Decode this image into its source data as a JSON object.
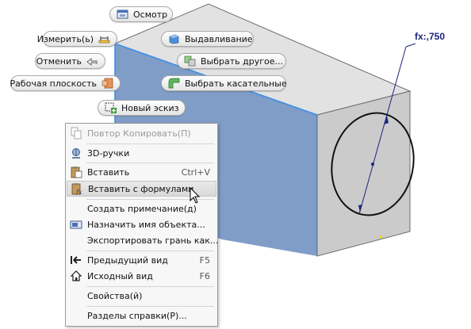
{
  "mini_toolbar": {
    "inspect": "Осмотр",
    "measure": "Измерить(ь)",
    "extrude": "Выдавливание",
    "undo": "Отменить",
    "select_other": "Выбрать другое...",
    "work_plane": "Рабочая плоскость",
    "select_tangent": "Выбрать касательные",
    "new_sketch": "Новый эскиз"
  },
  "dimension": {
    "label": "fx:,750"
  },
  "context_menu": {
    "items": [
      {
        "label": "Повтор Копировать(П)",
        "shortcut": "",
        "icon": "copy-icon",
        "disabled": true
      },
      {
        "label": "3D-ручки",
        "shortcut": "",
        "icon": "3d-grips-icon",
        "disabled": false
      },
      {
        "label": "Вставить",
        "shortcut": "Ctrl+V",
        "icon": "paste-icon",
        "disabled": false
      },
      {
        "label": "Вставить с формулами",
        "shortcut": "",
        "icon": "paste-formulas-icon",
        "disabled": false,
        "highlighted": true
      },
      {
        "label": "Создать примечание(д)",
        "shortcut": "",
        "icon": "",
        "disabled": false
      },
      {
        "label": "Назначить имя объекта...",
        "shortcut": "",
        "icon": "name-object-icon",
        "disabled": false
      },
      {
        "label": "Экспортировать грань как...",
        "shortcut": "",
        "icon": "",
        "disabled": false
      },
      {
        "label": "Предыдущий вид",
        "shortcut": "F5",
        "icon": "previous-view-icon",
        "disabled": false
      },
      {
        "label": "Исходный вид",
        "shortcut": "F6",
        "icon": "home-view-icon",
        "disabled": false
      },
      {
        "label": "Свойства(й)",
        "shortcut": "",
        "icon": "",
        "disabled": false
      },
      {
        "label": "Разделы справки(Р)...",
        "shortcut": "",
        "icon": "",
        "disabled": false
      }
    ]
  },
  "colors": {
    "selected_face": "#7f9dc7",
    "top_face": "#e2e2e2",
    "side_face": "#cbcbcb",
    "edge_highlight": "#3a8ee6",
    "dimension": "#1a237e",
    "menu_highlight": "#dcdcdc"
  }
}
